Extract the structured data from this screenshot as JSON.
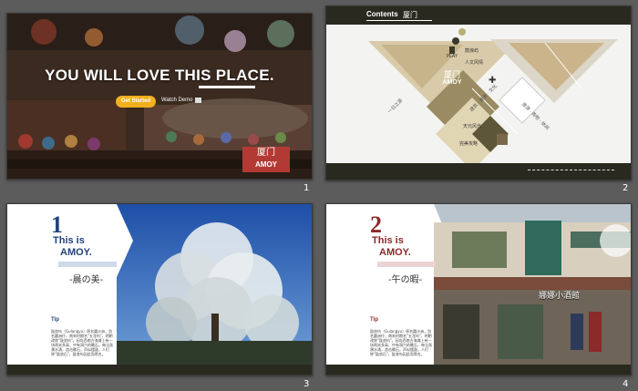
{
  "slides": [
    {
      "number": "1",
      "headline": "YOU WILL LOVE THIS PLACE.",
      "button_label": "Get Started",
      "link_label": "Watch Demo",
      "badge_cn": "厦门",
      "badge_en": "AMOY"
    },
    {
      "number": "2",
      "title": "Contents",
      "title_cn": "厦门",
      "play_label": "PLAY",
      "center_cn": "厦门",
      "center_en": "AMOY",
      "labels": [
        "鼓浪屿",
        "人文风情",
        "天元风光",
        "完美攻略"
      ],
      "diag_texts": [
        "建筑 · 美食 · 文化",
        "旅游 · 购物 · 休闲",
        "一日之游"
      ]
    },
    {
      "number": "3",
      "big_number": "1",
      "line1": "This is",
      "line2": "AMOY.",
      "subtitle": "-晨の美-",
      "tip": "Tip",
      "paragraph": "鼓浪屿（Gulangyu）原名圆沙洲，别名圆洲仔，南宋时期名\"五龙屿\"，明朝改称\"鼓浪屿\"。因岛西南方海滩上有一块两米多高、中有洞穴的礁石，每当涨潮水涌，浪击礁石，声似擂鼓，人们称\"鼓浪石\"，鼓浪屿因此而得名。"
    },
    {
      "number": "4",
      "big_number": "2",
      "line1": "This is",
      "line2": "AMOY.",
      "subtitle": "-午の暇-",
      "tip": "Tip",
      "paragraph": "鼓浪屿（Gulangyu）原名圆沙洲，别名圆洲仔，南宋时期名\"五龙屿\"，明朝改称\"鼓浪屿\"。因岛西南方海滩上有一块两米多高、中有洞穴的礁石，每当涨潮水涌，浪击礁石，声似擂鼓，人们称\"鼓浪石\"，鼓浪屿因此而得名。",
      "sign_text": "娜娜小酒館"
    }
  ],
  "colors": {
    "accent_yellow": "#f2b01e",
    "badge_red": "#b33a34",
    "blue_text": "#22427a",
    "red_text": "#8a2a2a",
    "dark_bar": "#29291f"
  }
}
